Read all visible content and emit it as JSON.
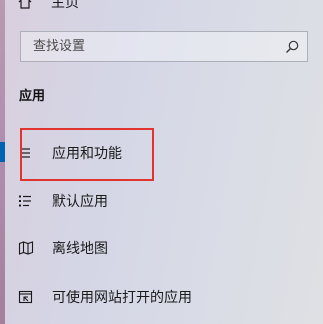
{
  "nav": {
    "home_label": "主页"
  },
  "search": {
    "placeholder": "查找设置"
  },
  "section": {
    "title": "应用"
  },
  "menu": {
    "items": [
      {
        "label": "应用和功能",
        "icon": "list-icon",
        "selected": true
      },
      {
        "label": "默认应用",
        "icon": "default-apps-icon",
        "selected": false
      },
      {
        "label": "离线地图",
        "icon": "map-icon",
        "selected": false
      },
      {
        "label": "可使用网站打开的应用",
        "icon": "open-website-icon",
        "selected": false
      }
    ]
  },
  "colors": {
    "accent": "#0063b1",
    "annotation_red": "#e2342f"
  }
}
